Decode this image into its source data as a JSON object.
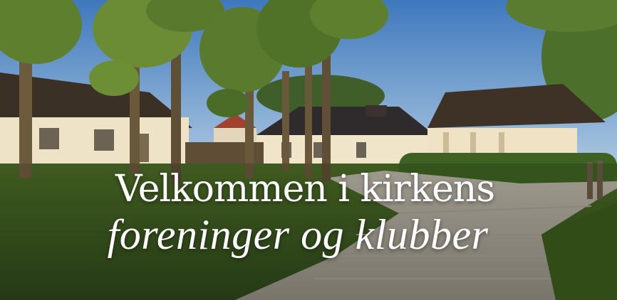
{
  "banner": {
    "headline_line1": "Velkommen i kirkens",
    "headline_line2": "foreninger og klubber"
  },
  "colors": {
    "sky": "#4f86c4",
    "lawn": "#3c5a1f",
    "walls": "#efe3c7",
    "roof": "#3a3026",
    "text": "#ffffff"
  }
}
